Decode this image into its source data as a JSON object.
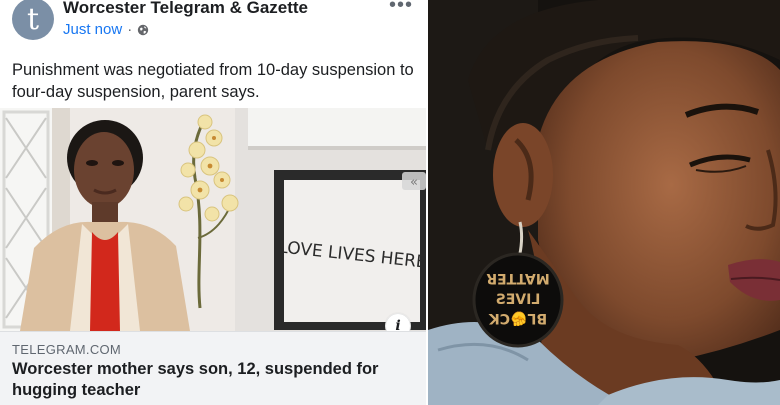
{
  "post": {
    "avatar_letter": "t",
    "page_name": "Worcester Telegram & Gazette",
    "timestamp": "Just now",
    "separator": "·",
    "privacy_icon": "globe-icon",
    "more_icon": "more-options-icon",
    "more_glyph": "•••",
    "text": "Punishment was negotiated from 10-day suspension to four-day suspension, parent says.",
    "image_sign_text": "LOVE LIVES HERE",
    "info_icon": "info-icon",
    "info_glyph": "i",
    "link": {
      "domain": "TELEGRAM.COM",
      "headline": "Worcester mother says son, 12, suspended for hugging teacher"
    }
  },
  "photo": {
    "earring_text": "BLACK LIVES MATTER"
  },
  "colors": {
    "link_blue": "#1877f2",
    "text_dark": "#1c1e21",
    "muted": "#606770",
    "preview_bg": "#f2f3f5",
    "avatar_bg": "#7b8fa6"
  }
}
